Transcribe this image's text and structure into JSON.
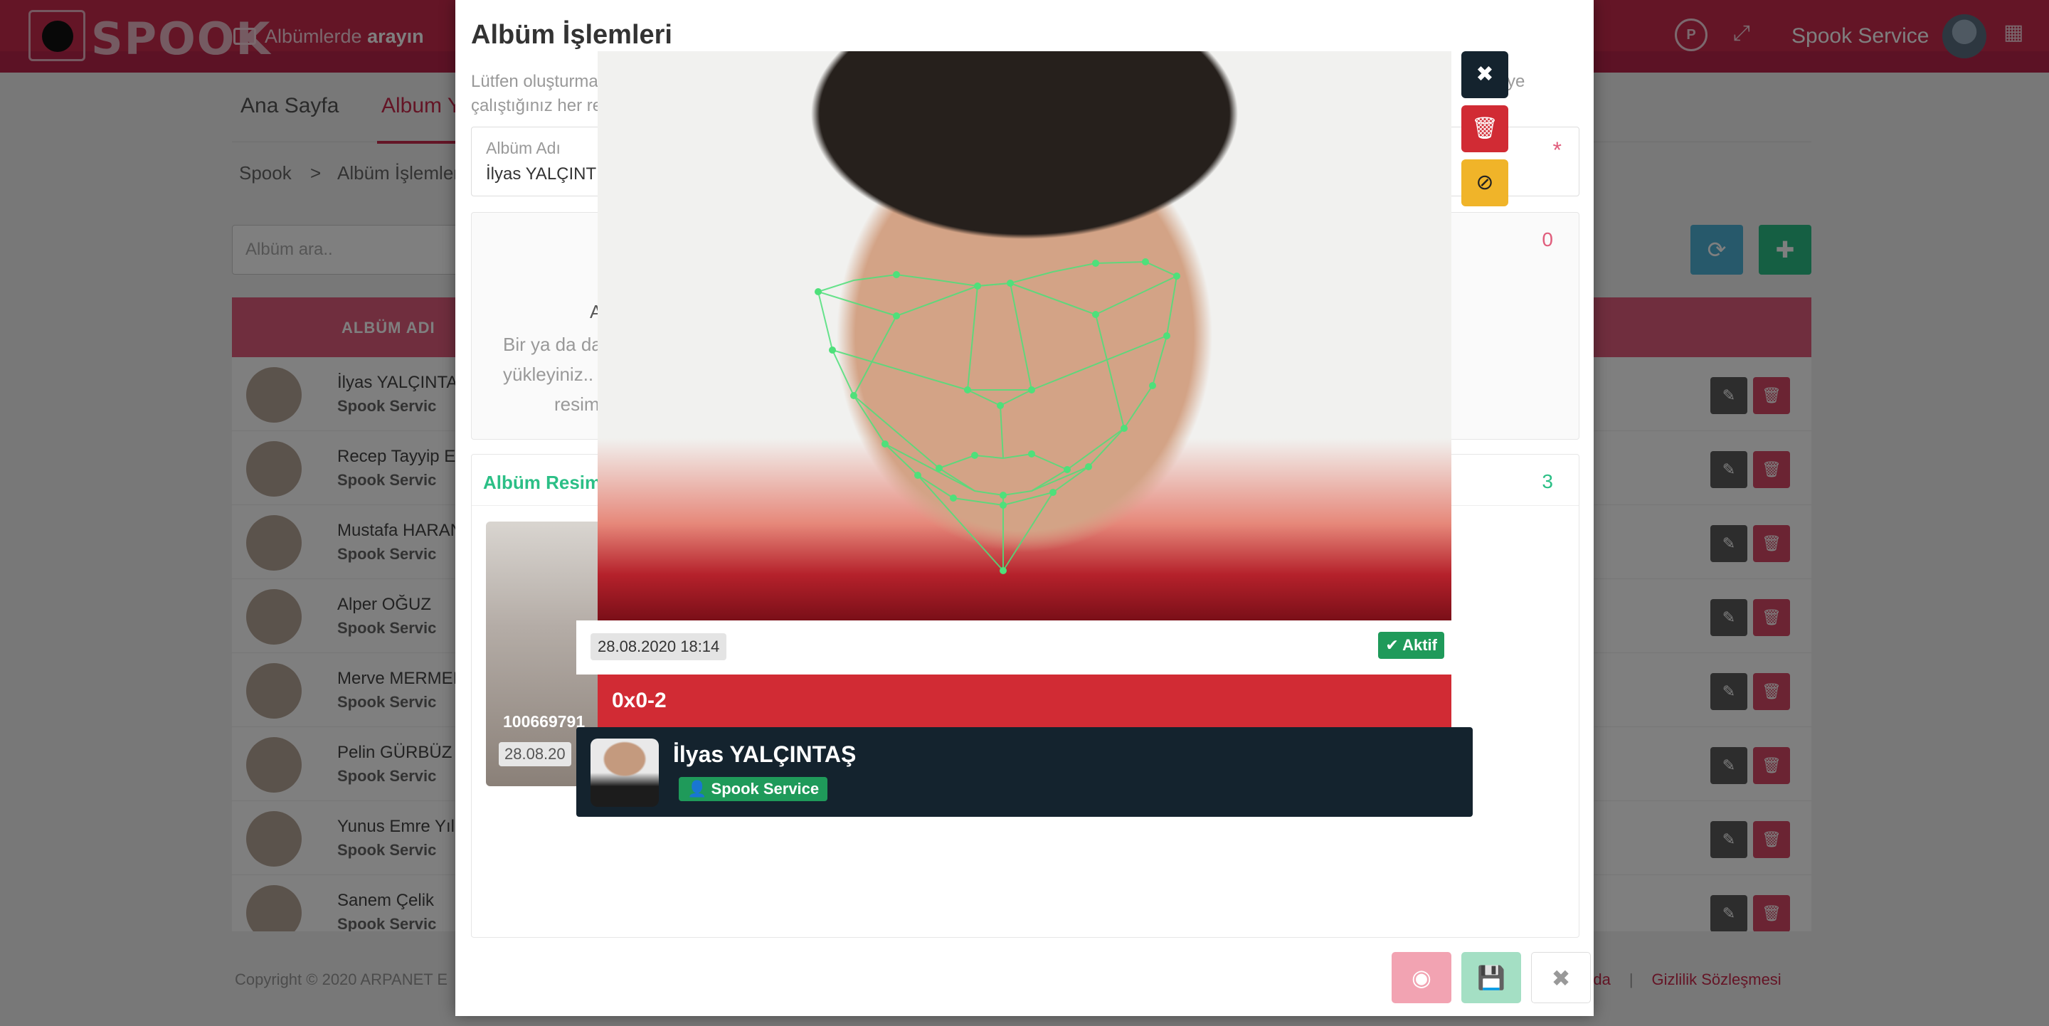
{
  "header": {
    "logo_text": "SPOOK",
    "search_prefix": "Albümlerde",
    "search_bold": "arayın",
    "profile_badge": "P",
    "user_name": "Spook Service",
    "icons": [
      "card-icon",
      "fullscreen-icon",
      "grid-icon"
    ]
  },
  "nav": {
    "home": "Ana Sayfa",
    "albums": "Album Y"
  },
  "breadcrumb": {
    "root": "Spook",
    "separator": ">",
    "current": "Albüm İşlemler"
  },
  "list": {
    "search_placeholder": "Albüm ara..",
    "column_name": "ALBÜM ADI",
    "rows": [
      {
        "name": "İlyas YALÇINTA",
        "owner": "Spook Servic"
      },
      {
        "name": "Recep Tayyip E",
        "owner": "Spook Servic"
      },
      {
        "name": "Mustafa HARAN",
        "owner": "Spook Servic"
      },
      {
        "name": "Alper OĞUZ",
        "owner": "Spook Servic"
      },
      {
        "name": "Merve MERMEI",
        "owner": "Spook Servic"
      },
      {
        "name": "Pelin GÜRBÜZ",
        "owner": "Spook Servic"
      },
      {
        "name": "Yunus Emre Yıl",
        "owner": "Spook Servic"
      },
      {
        "name": "Sanem Çelik",
        "owner": "Spook Servic"
      }
    ]
  },
  "footer": {
    "copyright": "Copyright © 2020 ARPANET E",
    "about": "kında",
    "sep": "|",
    "privacy": "Gizlilik Sözleşmesi"
  },
  "modal": {
    "title": "Albüm İşlemleri",
    "desc_line1": "Lütfen oluşturma",
    "desc_line2": "çalıştığınız her re",
    "desc_tail": "lemeye",
    "field_label": "Albüm Adı",
    "field_value": "İlyas YALÇINT",
    "required_mark": "*",
    "upload_count": "0",
    "upload_t1": "A",
    "upload_t2": "Bir ya da da",
    "upload_t3": "yükleyiniz..",
    "upload_t4": "resim",
    "images_title": "Albüm Resim",
    "images_count": "3",
    "thumb_id": "100669791",
    "thumb_date": "28.08.20"
  },
  "viewer": {
    "date": "28.08.2020 18:14",
    "status": "Aktif",
    "face_id": "0x0-2",
    "person_name": "İlyas YALÇINTAŞ",
    "person_tag": "Spook Service"
  },
  "colors": {
    "brand": "#c92a4c",
    "success": "#1f9a5a",
    "danger": "#d12b34",
    "warning": "#f0b429",
    "dark": "#14232e",
    "landmark": "#4ee07a"
  }
}
